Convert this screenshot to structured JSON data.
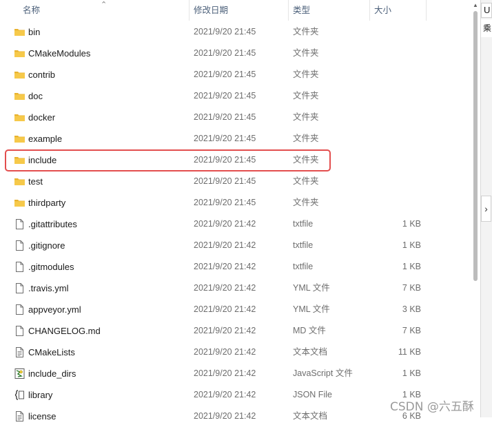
{
  "columns": {
    "name": "名称",
    "date": "修改日期",
    "type": "类型",
    "size": "大小"
  },
  "files": [
    {
      "name": "bin",
      "date": "2021/9/20 21:45",
      "type": "文件夹",
      "size": "",
      "icon": "folder-icon"
    },
    {
      "name": "CMakeModules",
      "date": "2021/9/20 21:45",
      "type": "文件夹",
      "size": "",
      "icon": "folder-icon"
    },
    {
      "name": "contrib",
      "date": "2021/9/20 21:45",
      "type": "文件夹",
      "size": "",
      "icon": "folder-icon"
    },
    {
      "name": "doc",
      "date": "2021/9/20 21:45",
      "type": "文件夹",
      "size": "",
      "icon": "folder-icon"
    },
    {
      "name": "docker",
      "date": "2021/9/20 21:45",
      "type": "文件夹",
      "size": "",
      "icon": "folder-icon"
    },
    {
      "name": "example",
      "date": "2021/9/20 21:45",
      "type": "文件夹",
      "size": "",
      "icon": "folder-icon"
    },
    {
      "name": "include",
      "date": "2021/9/20 21:45",
      "type": "文件夹",
      "size": "",
      "icon": "folder-icon"
    },
    {
      "name": "test",
      "date": "2021/9/20 21:45",
      "type": "文件夹",
      "size": "",
      "icon": "folder-icon"
    },
    {
      "name": "thirdparty",
      "date": "2021/9/20 21:45",
      "type": "文件夹",
      "size": "",
      "icon": "folder-icon"
    },
    {
      "name": ".gitattributes",
      "date": "2021/9/20 21:42",
      "type": "txtfile",
      "size": "1 KB",
      "icon": "file-icon"
    },
    {
      "name": ".gitignore",
      "date": "2021/9/20 21:42",
      "type": "txtfile",
      "size": "1 KB",
      "icon": "file-icon"
    },
    {
      "name": ".gitmodules",
      "date": "2021/9/20 21:42",
      "type": "txtfile",
      "size": "1 KB",
      "icon": "file-icon"
    },
    {
      "name": ".travis.yml",
      "date": "2021/9/20 21:42",
      "type": "YML 文件",
      "size": "7 KB",
      "icon": "file-icon"
    },
    {
      "name": "appveyor.yml",
      "date": "2021/9/20 21:42",
      "type": "YML 文件",
      "size": "3 KB",
      "icon": "file-icon"
    },
    {
      "name": "CHANGELOG.md",
      "date": "2021/9/20 21:42",
      "type": "MD 文件",
      "size": "7 KB",
      "icon": "file-icon"
    },
    {
      "name": "CMakeLists",
      "date": "2021/9/20 21:42",
      "type": "文本文档",
      "size": "11 KB",
      "icon": "text-document-icon"
    },
    {
      "name": "include_dirs",
      "date": "2021/9/20 21:42",
      "type": "JavaScript 文件",
      "size": "1 KB",
      "icon": "javascript-file-icon"
    },
    {
      "name": "library",
      "date": "2021/9/20 21:42",
      "type": "JSON File",
      "size": "1 KB",
      "icon": "json-file-icon"
    },
    {
      "name": "license",
      "date": "2021/9/20 21:42",
      "type": "文本文档",
      "size": "6 KB",
      "icon": "text-document-icon"
    }
  ],
  "highlighted_row": "include",
  "highlight_color": "#e34d4d",
  "folder_color": "#f3c13a",
  "right_panel": {
    "tab_text": "U",
    "sub_text": "乘"
  },
  "watermark": "CSDN @六五酥"
}
